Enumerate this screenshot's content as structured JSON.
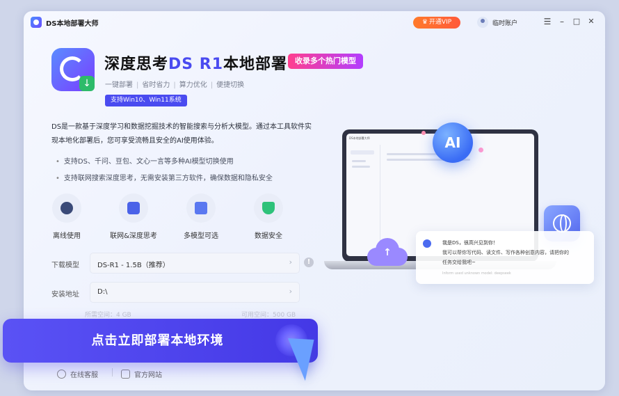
{
  "app": {
    "title": "DS本地部署大师"
  },
  "header": {
    "vip_label": "开通VIP",
    "user_label": "临时账户",
    "menu": "☰",
    "minimize": "–",
    "maximize": "□",
    "close": "✕"
  },
  "hero": {
    "title_part1": "深度思考",
    "title_ds": "DS R1",
    "title_part2": "本地部署",
    "badge": "收录多个热门模型",
    "subtags": [
      "一键部署",
      "省时省力",
      "算力优化",
      "便捷切换"
    ],
    "compat": "支持Win10、Win11系统"
  },
  "description": {
    "line1": "DS是一款基于深度学习和数据挖掘技术的智能搜索与分析大模型。通过本工具软件实",
    "line2": "现本地化部署后，您可享受流畅且安全的AI使用体验。",
    "bullets": [
      "支持DS、千问、豆包、文心一言等多种AI模型切换使用",
      "支持联网搜索深度思考，无需安装第三方软件，确保数据和隐私安全"
    ]
  },
  "features": [
    {
      "label": "离线使用",
      "icon": "offline-icon"
    },
    {
      "label": "联网&深度思考",
      "icon": "network-icon"
    },
    {
      "label": "多模型可选",
      "icon": "chip-icon"
    },
    {
      "label": "数据安全",
      "icon": "shield-icon"
    }
  ],
  "form": {
    "model_label": "下载模型",
    "model_value": "DS-R1 - 1.5B（推荐）",
    "path_label": "安装地址",
    "path_value": "D:\\",
    "required_space": "所需空间：4 GB",
    "available_space": "可用空间：500 GB"
  },
  "cta": {
    "label": "点击立即部署本地环境"
  },
  "footer": {
    "support": "在线客服",
    "website": "官方网站"
  },
  "illustration": {
    "orb_label": "AI",
    "chat_line1": "我是DS，很高兴见到你！",
    "chat_line2": "我可以帮你写代码、读文件、写作各种创意内容，请把你的",
    "chat_line3": "任务交给我吧~",
    "chat_footer": "Inform used unknown model: deepseek"
  },
  "colors": {
    "accent": "#4a4bf0",
    "vip": "#ff6a30",
    "badge": "#e03ea0"
  }
}
